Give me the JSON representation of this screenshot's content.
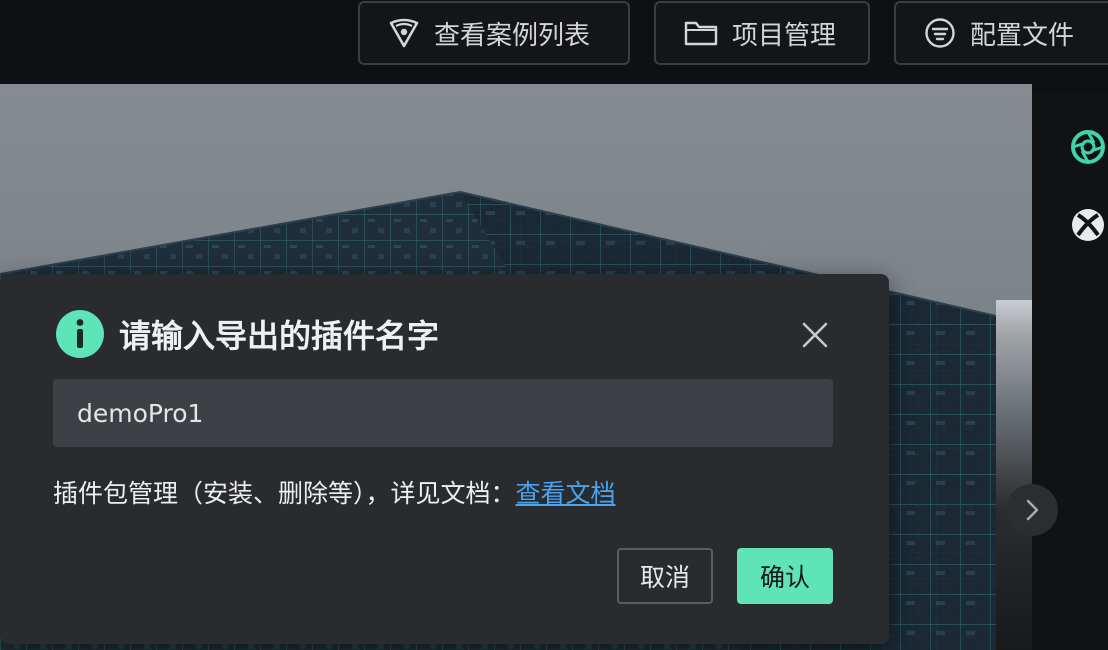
{
  "toolbar": {
    "cases_label": "查看案例列表",
    "projects_label": "项目管理",
    "config_label": "配置文件"
  },
  "dialog": {
    "title": "请输入导出的插件名字",
    "input_value": "demoPro1",
    "hint_text": "插件包管理（安装、删除等），详见文档：",
    "hint_link": "查看文档",
    "cancel_label": "取消",
    "confirm_label": "确认"
  },
  "icons": {
    "cases": "pin-location-icon",
    "projects": "folder-icon",
    "config": "filter-circle-icon",
    "right_panel": [
      "aperture-icon",
      "xbox-icon"
    ],
    "dialog_info": "info-icon",
    "dialog_close": "close-icon",
    "viewport_next": "chevron-right-icon"
  },
  "colors": {
    "accent": "#5ee4b7",
    "link": "#4aa3f0",
    "dialog_bg": "#2a2b2f",
    "input_bg": "#3f4045"
  }
}
